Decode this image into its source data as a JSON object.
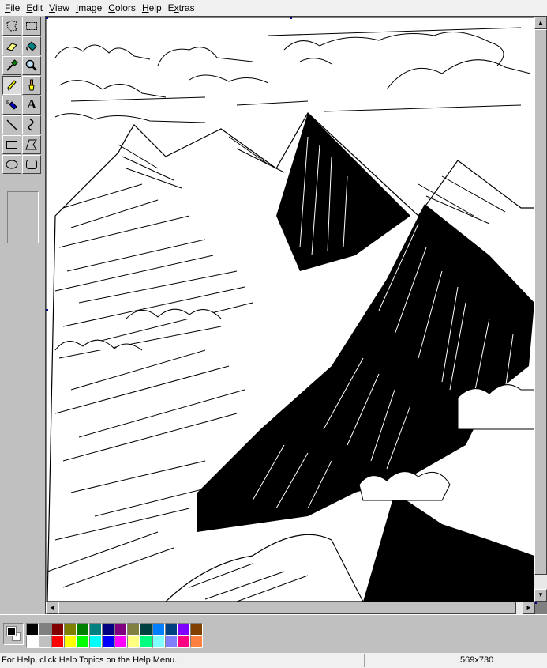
{
  "menu": [
    {
      "label": "File",
      "u": "F",
      "rest": "ile"
    },
    {
      "label": "Edit",
      "u": "E",
      "rest": "dit"
    },
    {
      "label": "View",
      "u": "V",
      "rest": "iew"
    },
    {
      "label": "Image",
      "u": "I",
      "rest": "mage"
    },
    {
      "label": "Colors",
      "u": "C",
      "rest": "olors"
    },
    {
      "label": "Help",
      "u": "H",
      "rest": "elp"
    },
    {
      "label": "Extras",
      "u": "x",
      "pre": "E",
      "rest": "tras"
    }
  ],
  "tools": [
    "free-form-select",
    "rectangle-select",
    "eraser",
    "fill-with-color",
    "pick-color",
    "magnifier",
    "pencil",
    "brush",
    "airbrush",
    "text",
    "line",
    "curve",
    "rectangle",
    "polygon",
    "ellipse",
    "rounded-rectangle"
  ],
  "selected_tool": "pencil",
  "text_tool_glyph": "A",
  "palette": {
    "row1": [
      "#000000",
      "#808080",
      "#800000",
      "#808000",
      "#008000",
      "#008080",
      "#000080",
      "#800080",
      "#808040",
      "#004040",
      "#0080ff",
      "#004080",
      "#8000ff",
      "#804000"
    ],
    "row2": [
      "#ffffff",
      "#c0c0c0",
      "#ff0000",
      "#ffff00",
      "#00ff00",
      "#00ffff",
      "#0000ff",
      "#ff00ff",
      "#ffff80",
      "#00ff80",
      "#80ffff",
      "#8080ff",
      "#ff0080",
      "#ff8040"
    ]
  },
  "foreground_color": "#000000",
  "background_color": "#ffffff",
  "status": {
    "help_text": "For Help, click Help Topics on the Help Menu.",
    "coordinates": "",
    "size": "569x730"
  },
  "scroll_arrows": {
    "up": "▲",
    "down": "▼",
    "left": "◄",
    "right": "►"
  }
}
